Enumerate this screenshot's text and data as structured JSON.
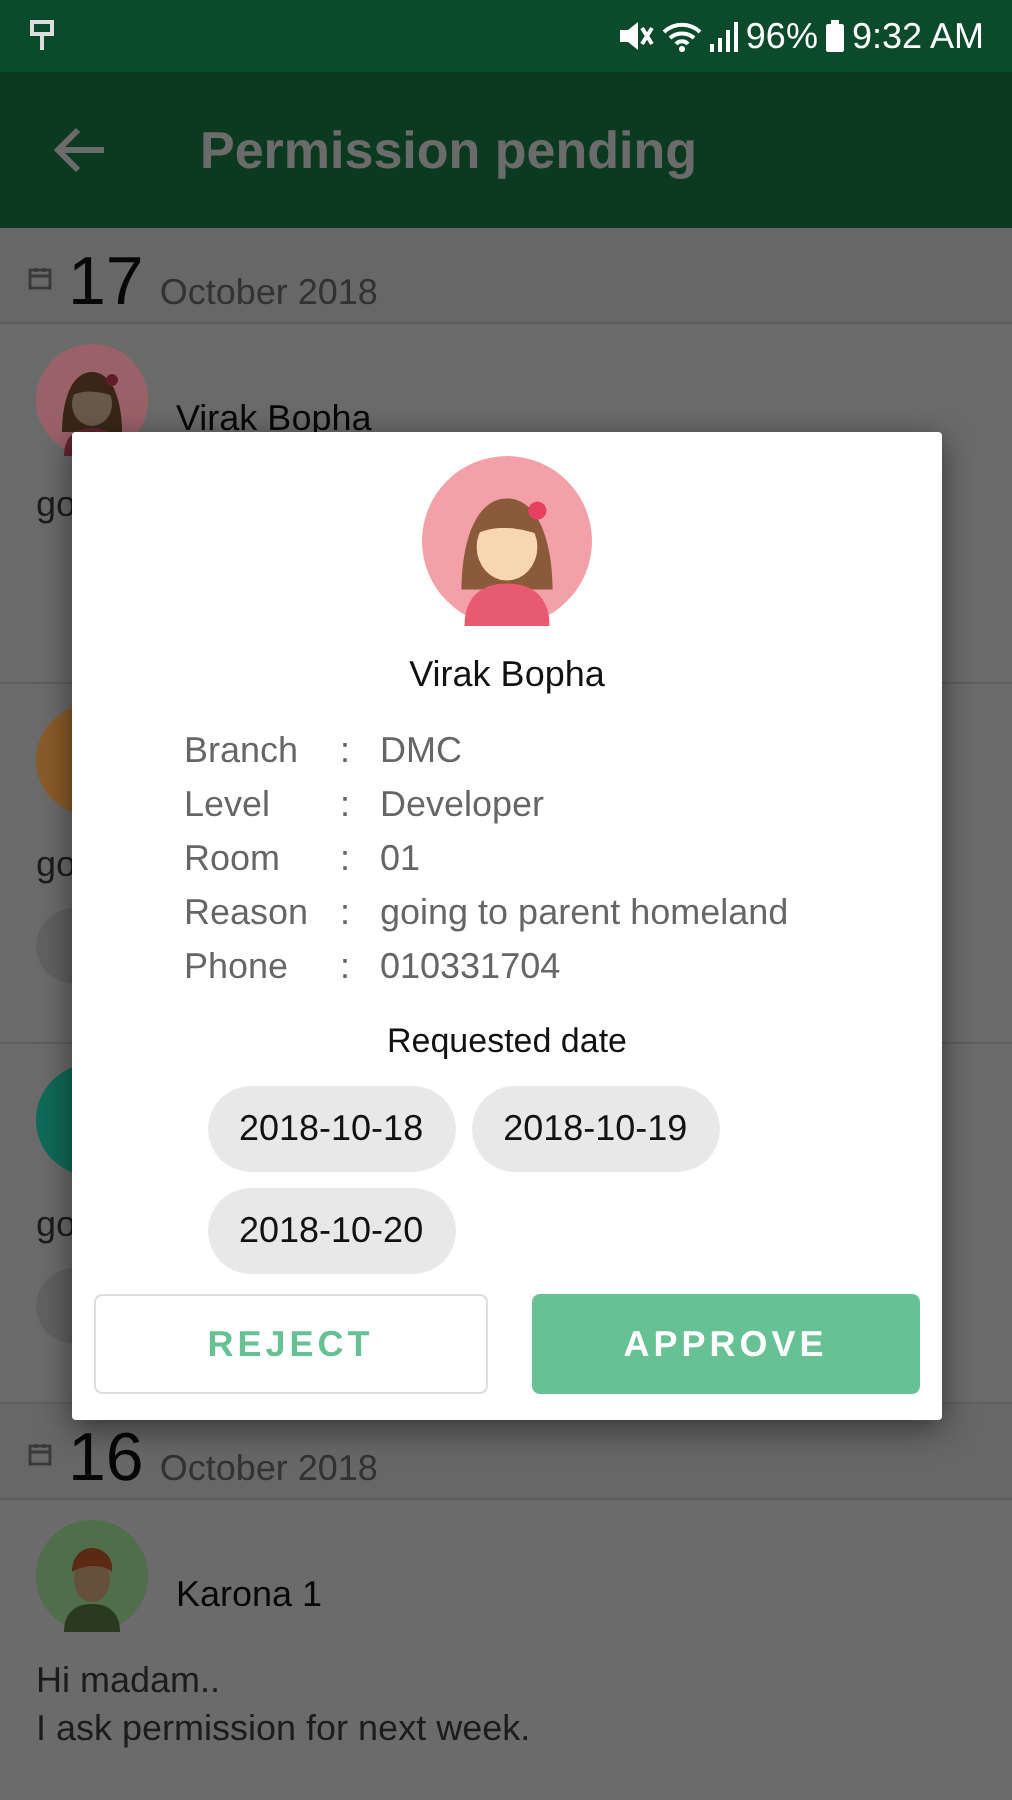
{
  "status_bar": {
    "battery": "96%",
    "time": "9:32 AM"
  },
  "app_bar": {
    "title": "Permission pending"
  },
  "sections": [
    {
      "day": "17",
      "month_year": "October 2018",
      "items": [
        {
          "name": "Virak Bopha",
          "kind": "girl",
          "color": "#9a6268",
          "message": [
            "go"
          ]
        },
        {
          "kind": "plain",
          "color": "#8a5c2a",
          "message": [
            "go"
          ]
        },
        {
          "kind": "plain",
          "color": "#0f6a58",
          "message": [
            "go"
          ]
        }
      ]
    },
    {
      "day": "16",
      "month_year": "October 2018",
      "items": [
        {
          "name": "Karona 1",
          "kind": "boy",
          "color": "#4f6e4a",
          "message": [
            "Hi madam..",
            "I ask permission for next week."
          ]
        }
      ]
    }
  ],
  "dialog": {
    "name": "Virak Bopha",
    "fields": [
      {
        "label": "Branch",
        "colon": ":",
        "value": "DMC"
      },
      {
        "label": "Level",
        "colon": ":",
        "value": "Developer"
      },
      {
        "label": "Room",
        "colon": ":",
        "value": "01"
      },
      {
        "label": "Reason",
        "colon": ":",
        "value": "going to parent homeland"
      },
      {
        "label": "Phone",
        "colon": ":",
        "value": "010331704"
      }
    ],
    "requested_label": "Requested date",
    "dates": [
      "2018-10-18",
      "2018-10-19",
      "2018-10-20"
    ],
    "buttons": [
      {
        "label": "REJECT",
        "kind": "outline"
      },
      {
        "label": "APPROVE",
        "kind": "filled"
      }
    ]
  }
}
